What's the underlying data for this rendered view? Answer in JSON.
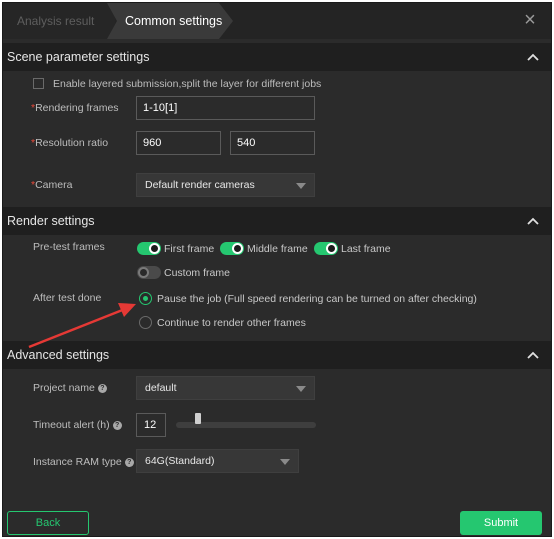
{
  "tabs": {
    "analysis": "Analysis result",
    "common": "Common settings"
  },
  "close_symbol": "×",
  "scene": {
    "title": "Scene parameter settings",
    "layered_label": "Enable layered submission,split the layer for different jobs",
    "rendering_frames_label": "Rendering frames",
    "rendering_frames_value": "1-10[1]",
    "resolution_label": "Resolution ratio",
    "resolution_width": "960",
    "resolution_height": "540",
    "camera_label": "Camera",
    "camera_value": "Default render cameras",
    "required_mark": "*"
  },
  "render": {
    "title": "Render settings",
    "pretest_label": "Pre-test frames",
    "first_frame": "First frame",
    "middle_frame": "Middle frame",
    "last_frame": "Last frame",
    "custom_frame": "Custom frame",
    "after_test_label": "After test done",
    "pause_option": "Pause the job (Full speed rendering can be turned on after checking)",
    "continue_option": "Continue to render other frames"
  },
  "advanced": {
    "title": "Advanced settings",
    "project_label": "Project name",
    "project_value": "default",
    "timeout_label": "Timeout alert (h)",
    "timeout_value": "12",
    "ram_label": "Instance RAM type",
    "ram_value": "64G(Standard)",
    "help_symbol": "?"
  },
  "buttons": {
    "back": "Back",
    "submit": "Submit"
  },
  "colors": {
    "accent": "#25c770",
    "required": "#e84a3a",
    "annotation_arrow": "#e53935"
  },
  "icons": [
    "close-icon",
    "chevron-up-icon",
    "help-icon",
    "caret-down-icon"
  ]
}
